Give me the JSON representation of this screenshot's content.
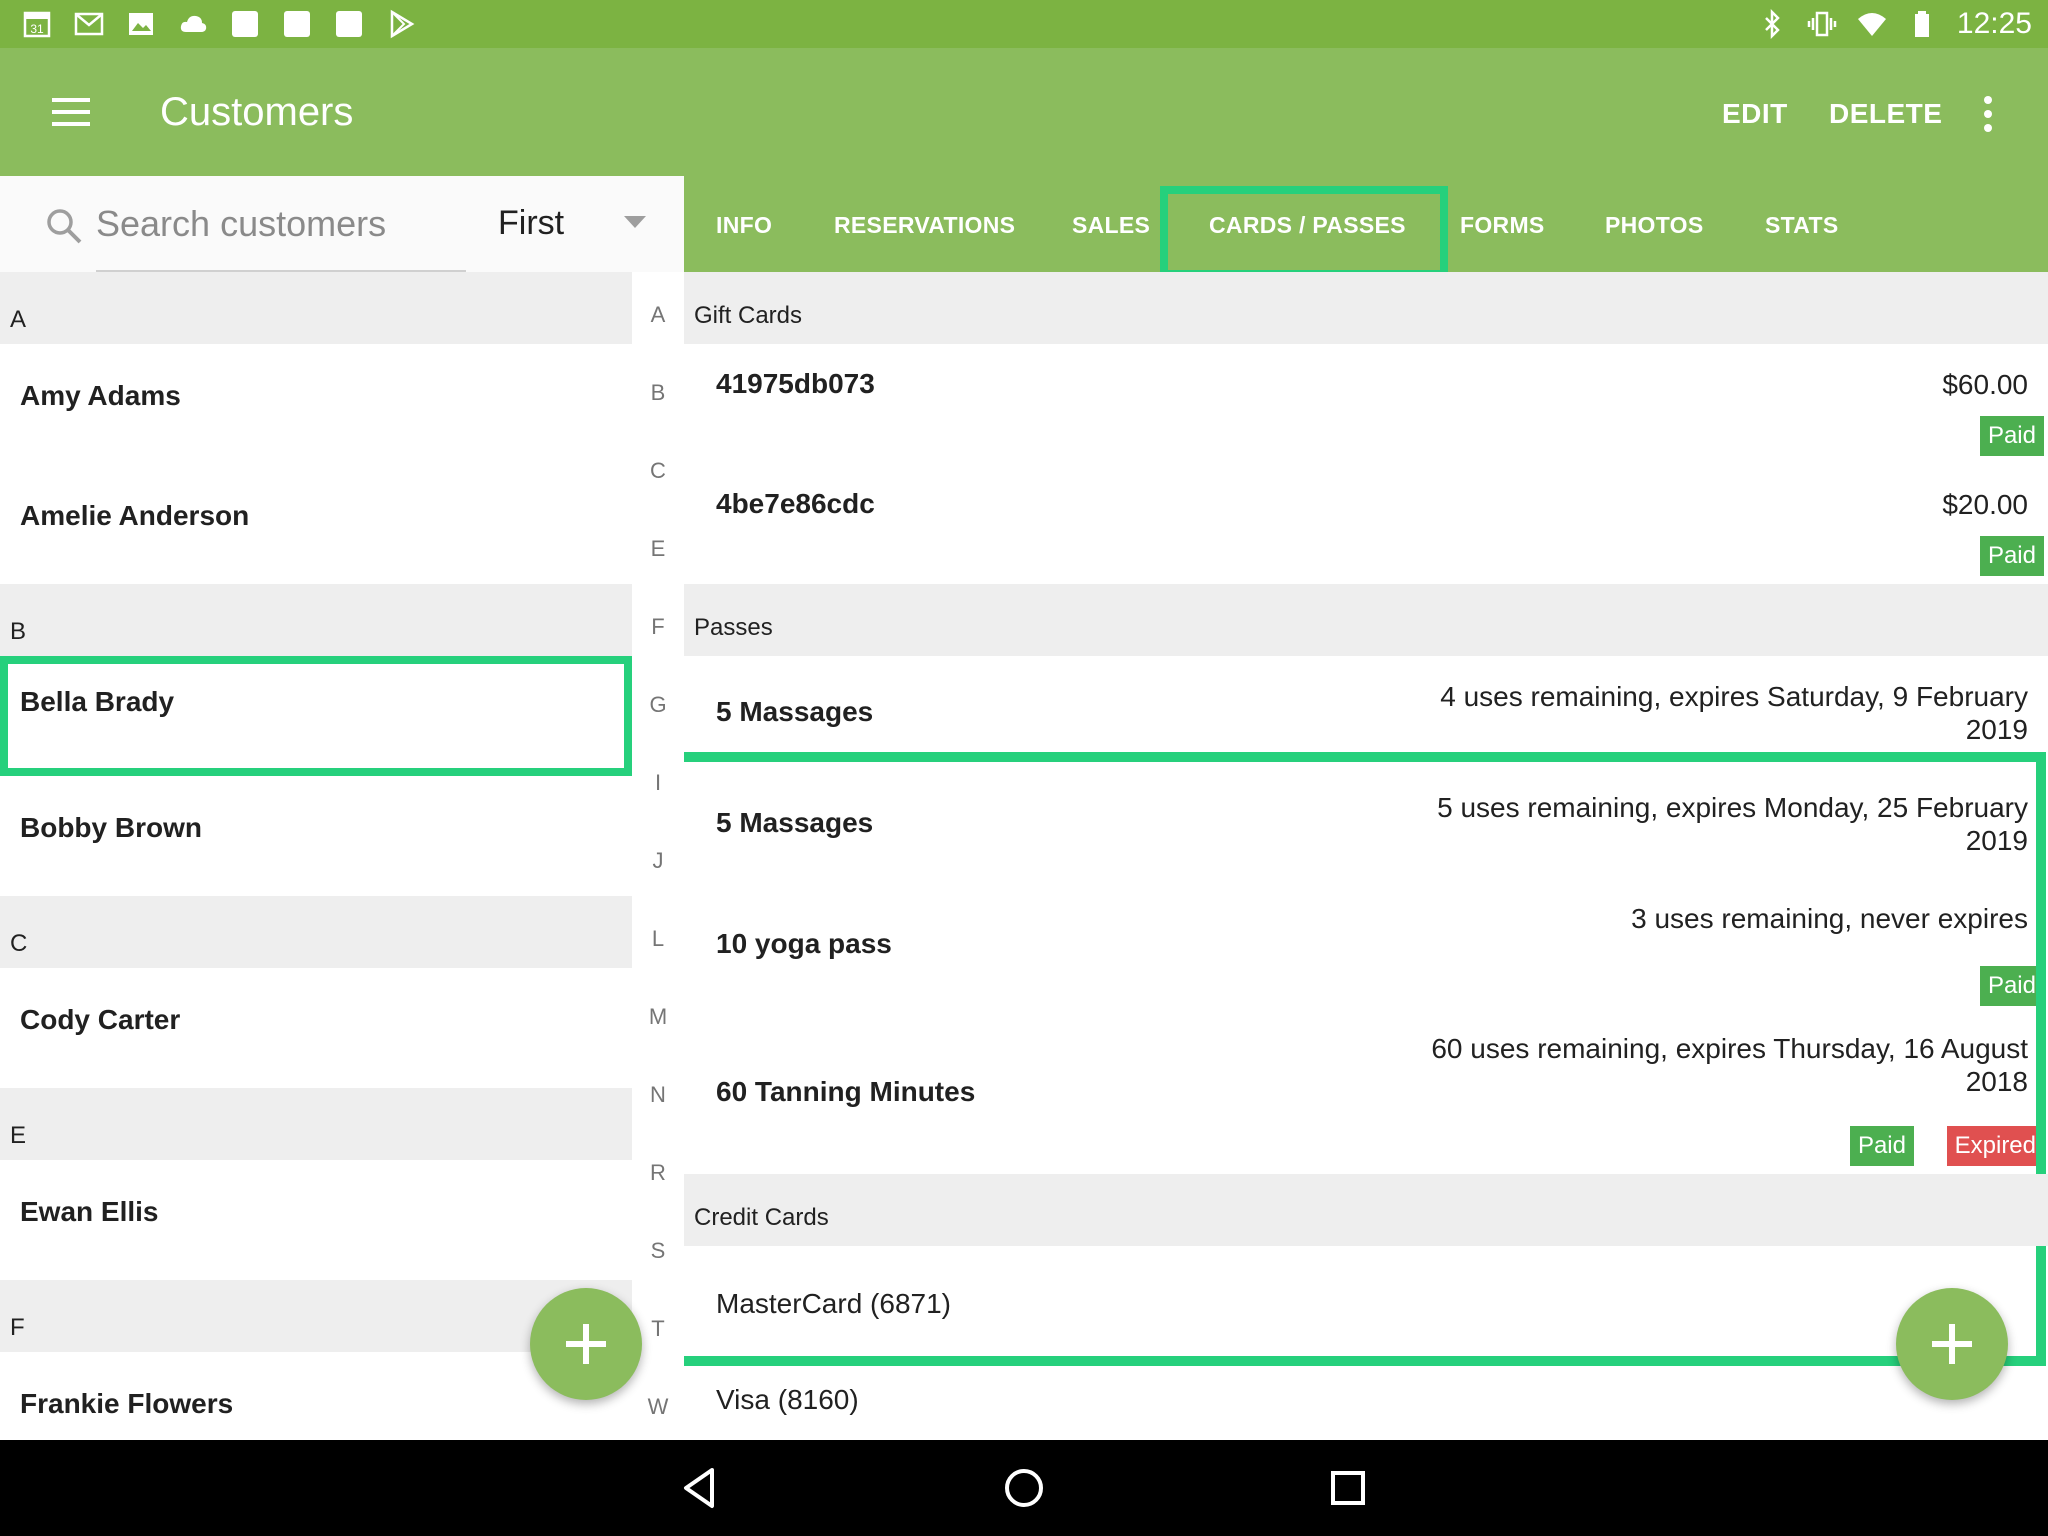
{
  "status_bar": {
    "time": "12:25",
    "left_icons": [
      "calendar-icon",
      "gmail-icon",
      "photos-icon",
      "cloud-icon",
      "blank-square-icon",
      "blank-square-icon",
      "blank-square-icon",
      "play-store-icon"
    ],
    "calendar_day": "31",
    "right_icons": [
      "bluetooth-icon",
      "vibrate-icon",
      "wifi-icon",
      "battery-icon"
    ]
  },
  "app_bar": {
    "title": "Customers",
    "edit_label": "EDIT",
    "delete_label": "DELETE",
    "menu_icon": "hamburger-menu-icon",
    "more_icon": "more-vert-icon"
  },
  "search": {
    "placeholder": "Search customers",
    "value": "",
    "sort_selected": "First"
  },
  "customer_sections": [
    {
      "letter": "A",
      "customers": [
        {
          "name": "Amy Adams",
          "selected": false
        },
        {
          "name": "Amelie Anderson",
          "selected": false
        }
      ]
    },
    {
      "letter": "B",
      "customers": [
        {
          "name": "Bella Brady",
          "selected": true
        },
        {
          "name": "Bobby Brown",
          "selected": false
        }
      ]
    },
    {
      "letter": "C",
      "customers": [
        {
          "name": "Cody Carter",
          "selected": false
        }
      ]
    },
    {
      "letter": "E",
      "customers": [
        {
          "name": "Ewan Ellis",
          "selected": false
        }
      ]
    },
    {
      "letter": "F",
      "customers": [
        {
          "name": "Frankie Flowers",
          "selected": false
        }
      ]
    }
  ],
  "alpha_index": [
    "A",
    "B",
    "C",
    "E",
    "F",
    "G",
    "I",
    "J",
    "L",
    "M",
    "N",
    "R",
    "S",
    "T",
    "W"
  ],
  "tabs": [
    {
      "label": "INFO",
      "active": false
    },
    {
      "label": "RESERVATIONS",
      "active": false
    },
    {
      "label": "SALES",
      "active": false
    },
    {
      "label": "CARDS / PASSES",
      "active": true
    },
    {
      "label": "FORMS",
      "active": false
    },
    {
      "label": "PHOTOS",
      "active": false
    },
    {
      "label": "STATS",
      "active": false
    }
  ],
  "gift_cards": {
    "header": "Gift Cards",
    "items": [
      {
        "code": "41975db073",
        "amount": "$60.00",
        "badge": "Paid"
      },
      {
        "code": "4be7e86cdc",
        "amount": "$20.00",
        "badge": "Paid"
      }
    ]
  },
  "passes": {
    "header": "Passes",
    "items": [
      {
        "name": "5 Massages",
        "detail_line1": "4 uses remaining, expires Saturday, 9 February",
        "detail_line2": "2019"
      },
      {
        "name": "5 Massages",
        "detail_line1": "5 uses remaining, expires Monday, 25 February",
        "detail_line2": "2019"
      },
      {
        "name": "10 yoga pass",
        "detail_line1": "3 uses remaining, never expires",
        "detail_line2": "",
        "badge": "Paid"
      },
      {
        "name": "60 Tanning Minutes",
        "detail_line1": "60 uses remaining, expires Thursday, 16 August",
        "detail_line2": "2018",
        "badge": "Paid",
        "badge2": "Expired"
      }
    ]
  },
  "credit_cards": {
    "header": "Credit Cards",
    "items": [
      {
        "label": "MasterCard (6871)"
      },
      {
        "label": "Visa (8160)"
      }
    ]
  },
  "fab_icon": "plus-icon",
  "colors": {
    "status_bar": "#7cb342",
    "app_bar": "#8bbc5d",
    "highlight": "#26d07c",
    "paid": "#4caf50",
    "expired": "#e05050"
  },
  "nav_icons": [
    "back-icon",
    "home-icon",
    "recents-icon"
  ]
}
